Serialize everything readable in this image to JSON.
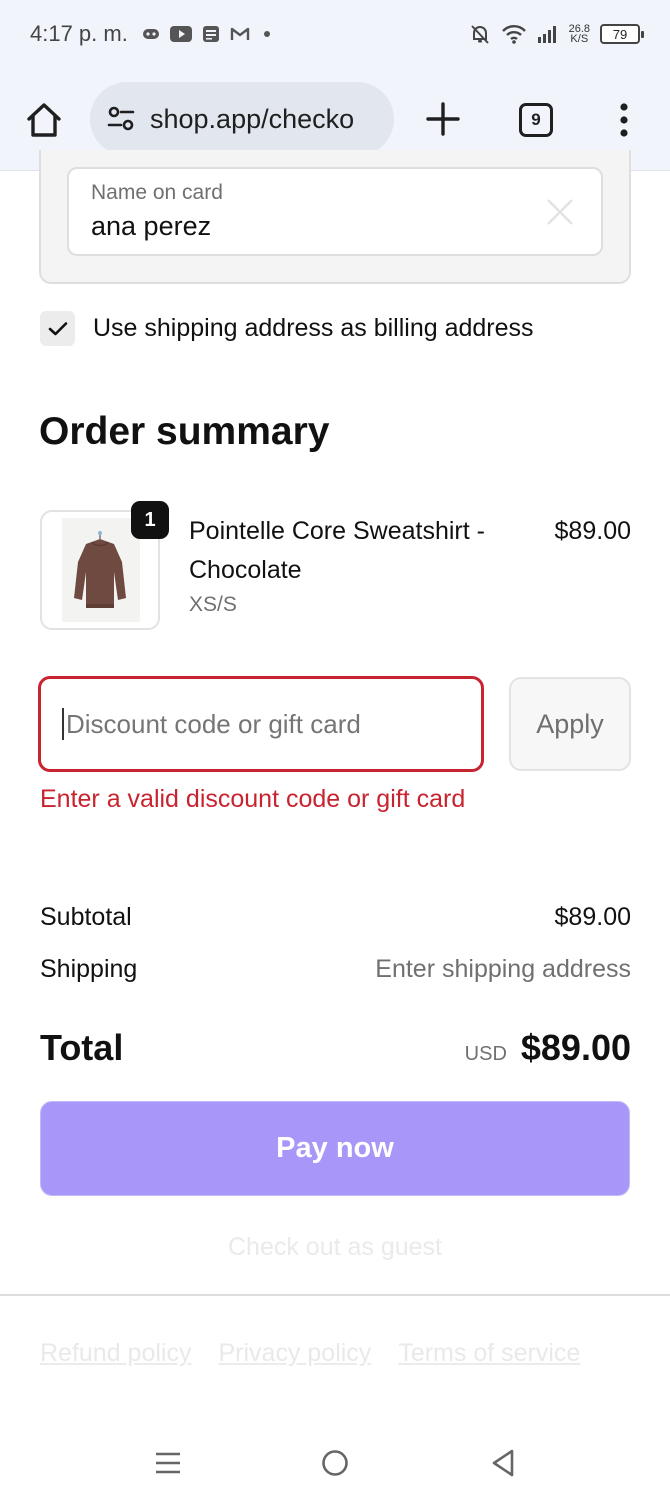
{
  "status_bar": {
    "time": "4:17 p. m.",
    "net_speed_value": "26.8",
    "net_speed_unit": "K/S",
    "battery": "79"
  },
  "browser": {
    "url": "shop.app/checko",
    "tab_count": "9"
  },
  "payment": {
    "name_label": "Name on card",
    "name_value": "ana perez",
    "billing_checkbox_label": "Use shipping address as billing address",
    "billing_checked": true
  },
  "order_summary": {
    "title": "Order summary",
    "item": {
      "quantity": "1",
      "name": "Pointelle Core Sweatshirt - Chocolate",
      "variant": "XS/S",
      "price": "$89.00"
    },
    "discount": {
      "placeholder": "Discount code or gift card",
      "apply_label": "Apply",
      "error": "Enter a valid discount code or gift card"
    },
    "subtotal_label": "Subtotal",
    "subtotal_value": "$89.00",
    "shipping_label": "Shipping",
    "shipping_value": "Enter shipping address",
    "total_label": "Total",
    "total_currency": "USD",
    "total_value": "$89.00"
  },
  "actions": {
    "pay_label": "Pay now",
    "guest_label": "Check out as guest"
  },
  "footer": {
    "links": [
      "Refund policy",
      "Privacy policy",
      "Terms of service"
    ]
  },
  "colors": {
    "accent_pay": "#a897f8",
    "error": "#c8242f",
    "browser_chrome": "#f1f5fb"
  }
}
